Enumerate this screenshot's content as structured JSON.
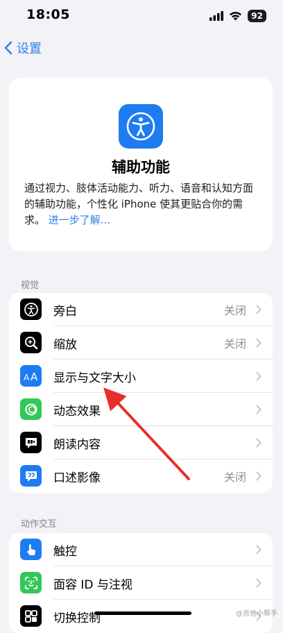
{
  "status_bar": {
    "time": "18:05",
    "battery": "92"
  },
  "nav": {
    "back_label": "设置"
  },
  "header": {
    "title": "辅助功能",
    "description": "通过视力、肢体活动能力、听力、语音和认知方面的辅助功能，个性化 iPhone 使其更贴合你的需求。",
    "learn_more": "进一步了解..."
  },
  "sections": {
    "vision": {
      "label": "视觉",
      "items": [
        {
          "label": "旁白",
          "value": "关闭",
          "icon": "voiceover-icon",
          "color": "#000000"
        },
        {
          "label": "缩放",
          "value": "关闭",
          "icon": "zoom-icon",
          "color": "#000000"
        },
        {
          "label": "显示与文字大小",
          "value": "",
          "icon": "text-size-icon",
          "color": "#1d7cf2"
        },
        {
          "label": "动态效果",
          "value": "",
          "icon": "motion-icon",
          "color": "#34c759"
        },
        {
          "label": "朗读内容",
          "value": "",
          "icon": "spoken-content-icon",
          "color": "#000000"
        },
        {
          "label": "口述影像",
          "value": "关闭",
          "icon": "audio-description-icon",
          "color": "#1d7cf2"
        }
      ]
    },
    "interaction": {
      "label": "动作交互",
      "items": [
        {
          "label": "触控",
          "value": "",
          "icon": "touch-icon",
          "color": "#1d7cf2"
        },
        {
          "label": "面容 ID 与注视",
          "value": "",
          "icon": "face-id-icon",
          "color": "#34c759"
        },
        {
          "label": "切换控制",
          "value": "",
          "icon": "switch-control-icon",
          "color": "#000000"
        }
      ]
    }
  },
  "watermark": "@吉他小帮手"
}
